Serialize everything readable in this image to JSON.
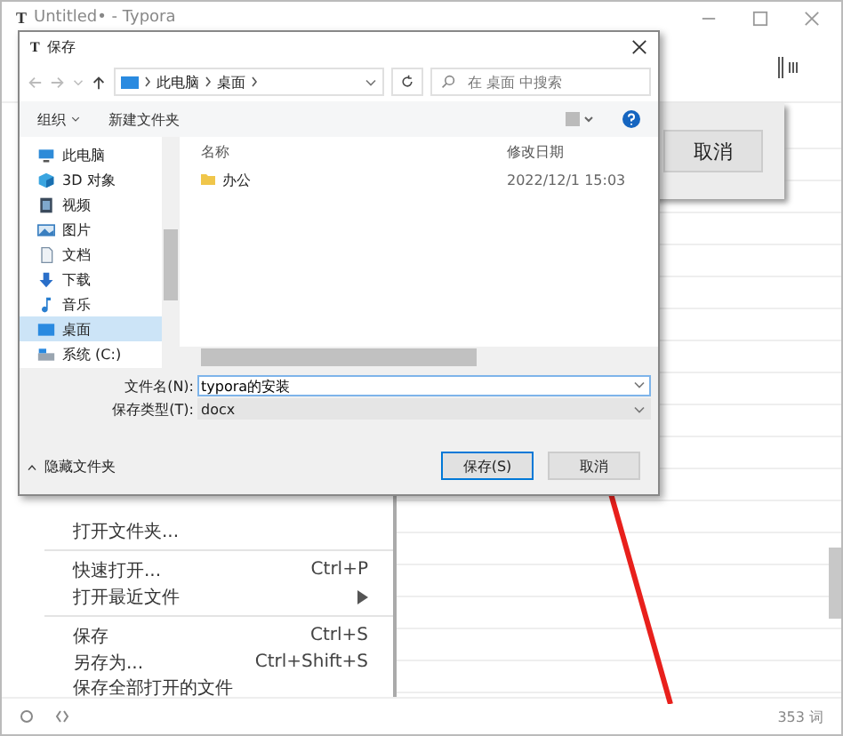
{
  "window": {
    "app_icon": "T",
    "title": "Untitled• - Typora"
  },
  "behind_dialog": {
    "button": "取消"
  },
  "save_dialog": {
    "app_icon": "T",
    "title": "保存",
    "breadcrumb": [
      "此电脑",
      "桌面"
    ],
    "search": {
      "placeholder": "在 桌面 中搜索"
    },
    "commands": [
      "组织",
      "新建文件夹"
    ],
    "nav_tree": [
      {
        "kind": "pc",
        "label": "此电脑",
        "selected": false
      },
      {
        "kind": "cube",
        "label": "3D 对象",
        "selected": false
      },
      {
        "kind": "video",
        "label": "视频",
        "selected": false
      },
      {
        "kind": "pictures",
        "label": "图片",
        "selected": false
      },
      {
        "kind": "documents",
        "label": "文档",
        "selected": false
      },
      {
        "kind": "downloads",
        "label": "下载",
        "selected": false
      },
      {
        "kind": "music",
        "label": "音乐",
        "selected": false
      },
      {
        "kind": "desktop",
        "label": "桌面",
        "selected": true
      },
      {
        "kind": "drive",
        "label": "系统 (C:)",
        "selected": false
      }
    ],
    "columns": [
      "名称",
      "修改日期"
    ],
    "files": [
      {
        "name": "办公",
        "modified": "2022/12/1 15:03"
      }
    ],
    "file_name": {
      "label": "文件名(N):",
      "value": "typora的安装"
    },
    "file_type": {
      "label": "保存类型(T):",
      "value": "docx"
    },
    "hide_folders": "隐藏文件夹",
    "buttons": [
      {
        "label": "保存(S)",
        "default": true
      },
      {
        "label": "取消",
        "default": false
      }
    ]
  },
  "menu": [
    {
      "kind": "item",
      "label": "打开文件夹...",
      "submenu": false
    },
    {
      "kind": "divider"
    },
    {
      "kind": "item",
      "label": "快速打开...",
      "shortcut": "Ctrl+P",
      "submenu": false
    },
    {
      "kind": "item",
      "label": "打开最近文件",
      "submenu": true
    },
    {
      "kind": "divider"
    },
    {
      "kind": "item",
      "label": "保存",
      "shortcut": "Ctrl+S",
      "submenu": false
    },
    {
      "kind": "item",
      "label": "另存为...",
      "shortcut": "Ctrl+Shift+S",
      "submenu": false
    },
    {
      "kind": "item",
      "label": "保存全部打开的文件",
      "submenu": false
    }
  ],
  "status_bar": {
    "word_count": "353 词"
  }
}
